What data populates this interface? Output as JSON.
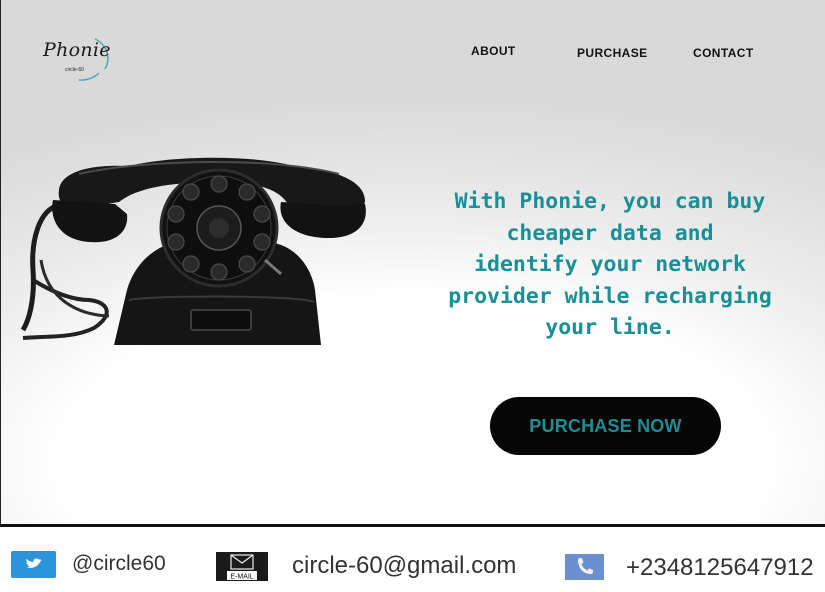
{
  "brand": {
    "name": "Phonie",
    "tagline_small": "circle-60"
  },
  "nav": [
    {
      "label": "ABOUT"
    },
    {
      "label": "PURCHASE"
    },
    {
      "label": "CONTACT"
    }
  ],
  "hero": {
    "headline": "With Phonie, you can buy\ncheaper data and\n identify your network\nprovider while recharging\nyour line.",
    "cta_label": "PURCHASE NOW"
  },
  "footer": {
    "twitter": "@circle60",
    "email_icon_label": "E-MAIL",
    "email": "circle-60@gmail.com",
    "phone": "+2348125647912"
  },
  "colors": {
    "accent": "#1a8f95",
    "button": "#050505"
  },
  "icons": [
    "twitter-icon",
    "email-icon",
    "phone-icon",
    "rotary-telephone-image"
  ]
}
